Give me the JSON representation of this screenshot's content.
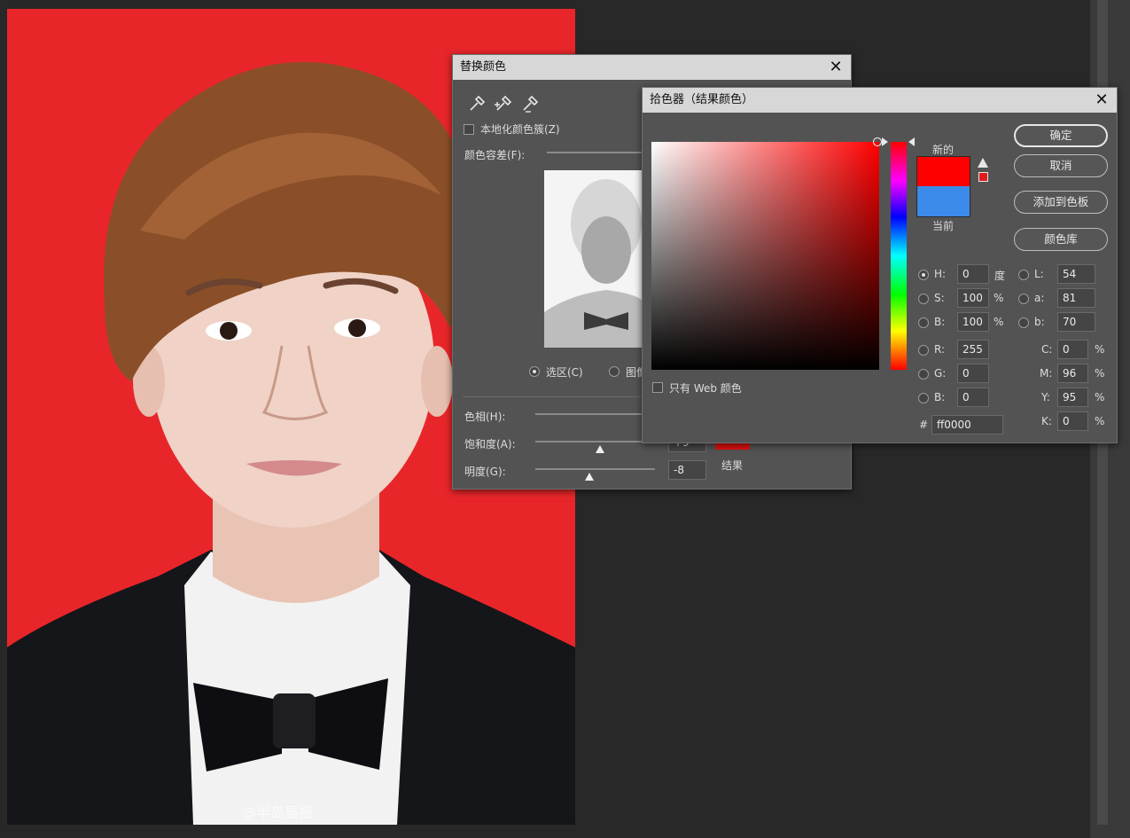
{
  "replace_color": {
    "title": "替换颜色",
    "localized_clusters_label": "本地化颜色簇(Z)",
    "fuzziness_label": "颜色容差(F):",
    "radio_selection": "选区(C)",
    "radio_image": "图像",
    "hue_label": "色相(H):",
    "saturation_label": "饱和度(A):",
    "lightness_label": "明度(G):",
    "saturation_value": "+9",
    "lightness_value": "-8",
    "result_label": "结果",
    "result_color": "#e01010"
  },
  "color_picker": {
    "title": "拾色器（结果颜色）",
    "ok_label": "确定",
    "cancel_label": "取消",
    "add_swatch_label": "添加到色板",
    "color_library_label": "颜色库",
    "new_label": "新的",
    "current_label": "当前",
    "new_color": "#ff0000",
    "current_color": "#3c8aea",
    "web_only_label": "只有 Web 颜色",
    "fields": {
      "h_label": "H:",
      "h_value": "0",
      "h_unit": "度",
      "s_label": "S:",
      "s_value": "100",
      "s_unit": "%",
      "b_label": "B:",
      "b_value": "100",
      "b_unit": "%",
      "r_label": "R:",
      "r_value": "255",
      "g_label": "G:",
      "g_value": "0",
      "bl_label": "B:",
      "bl_value": "0",
      "l_label": "L:",
      "l_value": "54",
      "a_label": "a:",
      "a_value": "81",
      "lb_label": "b:",
      "lb_value": "70",
      "c_label": "C:",
      "c_value": "0",
      "c_unit": "%",
      "m_label": "M:",
      "m_value": "96",
      "m_unit": "%",
      "y_label": "Y:",
      "y_value": "95",
      "y_unit": "%",
      "k_label": "K:",
      "k_value": "0",
      "k_unit": "%",
      "hex_label": "#",
      "hex_value": "ff0000"
    }
  },
  "watermark": "@半岛晨报",
  "colors": {
    "photo_background": "#e8262a",
    "dialog_background": "#535353",
    "titlebar": "#d7d7d7"
  }
}
